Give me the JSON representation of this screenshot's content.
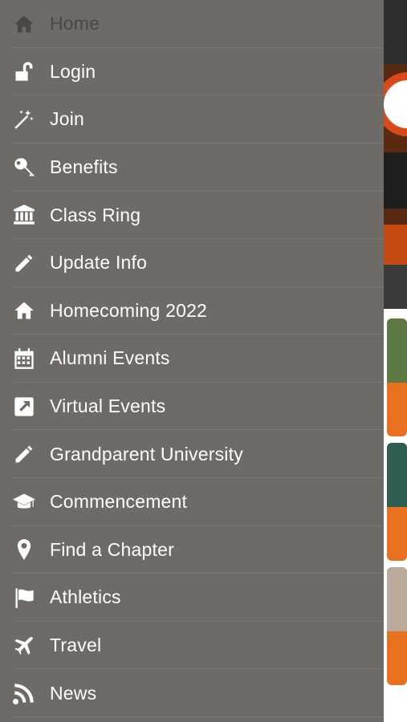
{
  "menu": {
    "items": [
      {
        "label": "Home",
        "icon": "home-icon"
      },
      {
        "label": "Login",
        "icon": "unlock-icon"
      },
      {
        "label": "Join",
        "icon": "magic-wand-icon"
      },
      {
        "label": "Benefits",
        "icon": "key-icon"
      },
      {
        "label": "Class Ring",
        "icon": "bank-icon"
      },
      {
        "label": "Update Info",
        "icon": "pencil-icon"
      },
      {
        "label": "Homecoming 2022",
        "icon": "home-icon"
      },
      {
        "label": "Alumni Events",
        "icon": "calendar-icon"
      },
      {
        "label": "Virtual Events",
        "icon": "external-link-icon"
      },
      {
        "label": "Grandparent University",
        "icon": "pencil-icon"
      },
      {
        "label": "Commencement",
        "icon": "graduation-cap-icon"
      },
      {
        "label": "Find a Chapter",
        "icon": "map-marker-icon"
      },
      {
        "label": "Athletics",
        "icon": "flag-icon"
      },
      {
        "label": "Travel",
        "icon": "plane-icon"
      },
      {
        "label": "News",
        "icon": "rss-icon"
      }
    ]
  },
  "colors": {
    "drawer_bg": "#6e6a65",
    "text": "#ffffff",
    "accent": "#e8711f"
  }
}
